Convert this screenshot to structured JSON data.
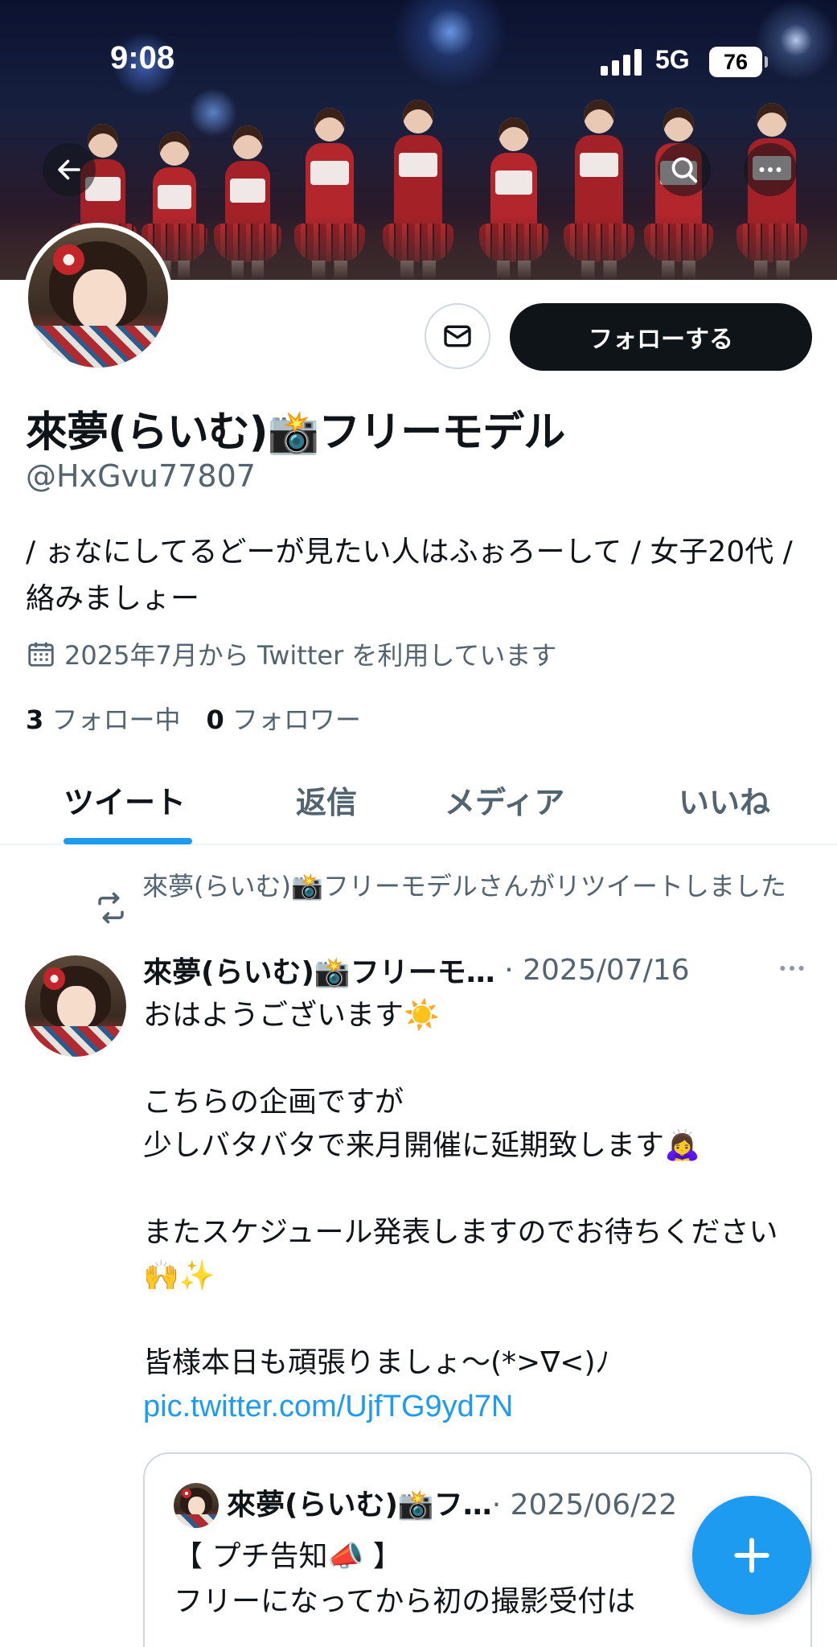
{
  "status_bar": {
    "time": "9:08",
    "network": "5G",
    "battery": "76"
  },
  "header": {
    "icons": [
      "back-arrow-icon",
      "search-icon",
      "more-icon"
    ]
  },
  "profile": {
    "display_name": "來夢(らいむ)📸フリーモデル",
    "handle": "@HxGvu77807",
    "bio": "/ ぉなにしてるどーが見たい人はふぉろーして / 女子20代 / 絡みましょー",
    "joined": "2025年7月から Twitter を利用しています",
    "following_count": "3",
    "following_label": "フォロー中",
    "followers_count": "0",
    "followers_label": "フォロワー",
    "follow_button": "フォローする"
  },
  "tabs": [
    {
      "label": "ツイート",
      "active": true
    },
    {
      "label": "返信",
      "active": false
    },
    {
      "label": "メディア",
      "active": false
    },
    {
      "label": "いいね",
      "active": false
    }
  ],
  "tweet": {
    "retweet_notice": "來夢(らいむ)📸フリーモデルさんがリツイートしました",
    "author": "來夢(らいむ)📸フリーモ…",
    "date": "· 2025/07/16",
    "body": "おはようございます☀️\n\nこちらの企画ですが\n少しバタバタで来月開催に延期致します🙇‍♀️\n\nまたスケジュール発表しますのでお待ちください🙌✨\n\n皆様本日も頑張りましょ〜(*>∇<)ﾉ",
    "link": "pic.twitter.com/UjfTG9yd7N",
    "quote": {
      "author": "來夢(らいむ)📸フ…",
      "date": "· 2025/06/22",
      "body": "【 プチ告知📣 】\nフリーになってから初の撮影受付は"
    }
  },
  "colors": {
    "accent": "#1d9bf0",
    "text": "#0f1419",
    "secondary": "#536471",
    "border": "#cfd9de"
  }
}
